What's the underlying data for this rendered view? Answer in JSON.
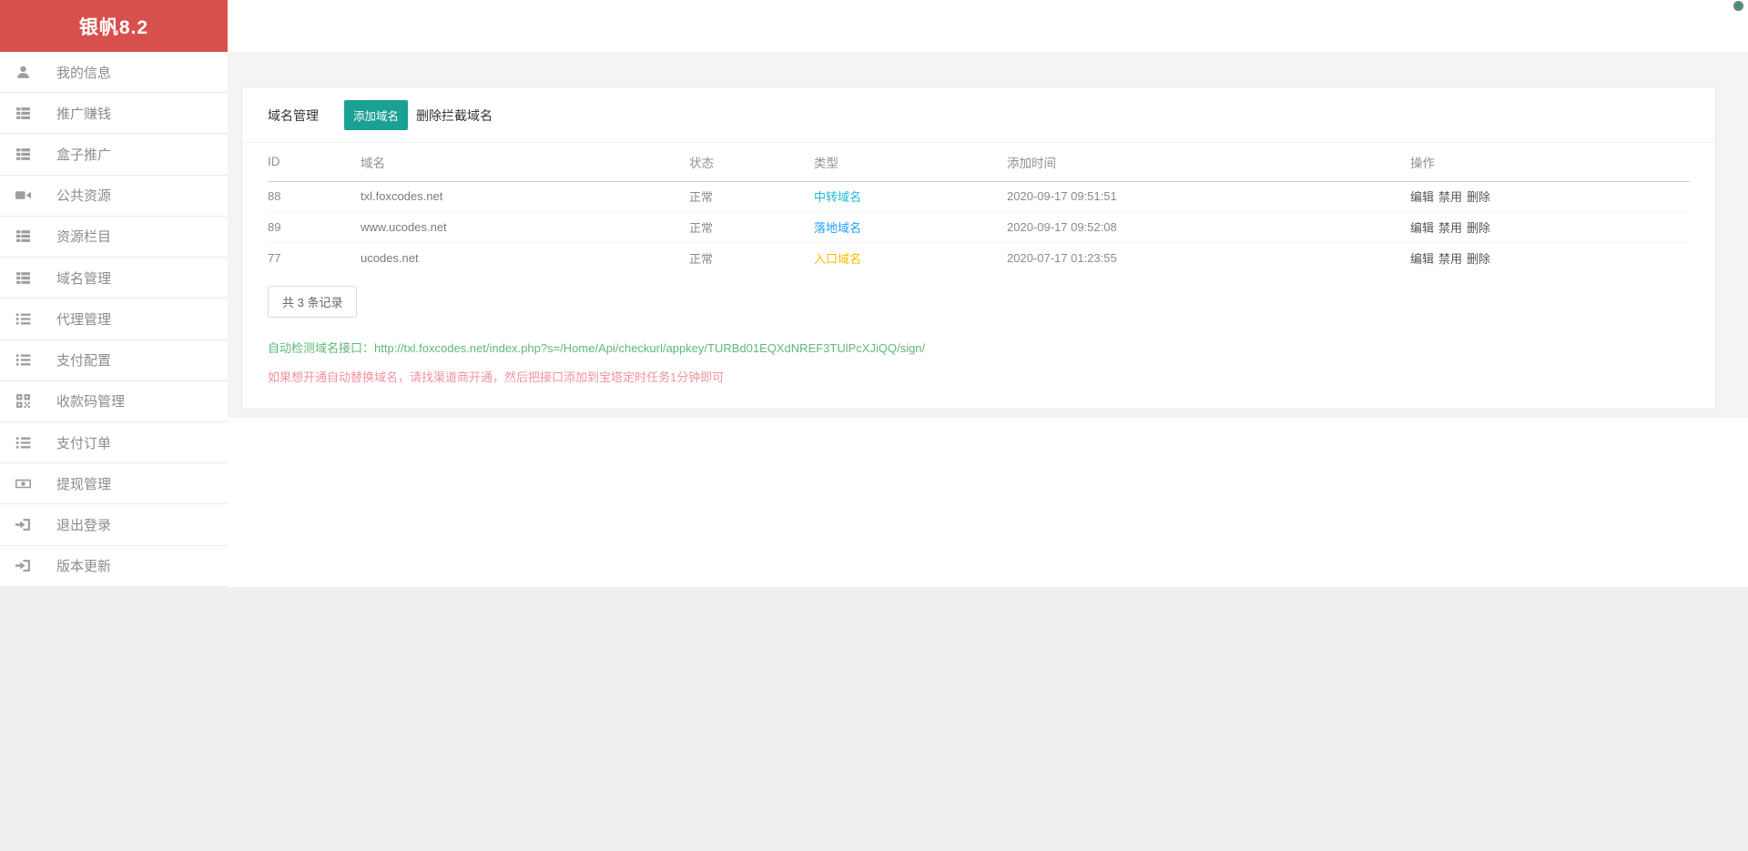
{
  "app": {
    "title": "银帆8.2"
  },
  "colors": {
    "brand": "#d8504d",
    "accent": "#1aa094",
    "type_transit": "#1cbbd4",
    "type_landing": "#1e9fff",
    "type_entry": "#ffb800",
    "success_text": "#5fb878",
    "warning_text": "#f1939e"
  },
  "sidebar": {
    "items": [
      {
        "label": "我的信息",
        "icon": "user-icon"
      },
      {
        "label": "推广赚钱",
        "icon": "th-list-icon"
      },
      {
        "label": "盒子推广",
        "icon": "th-list-icon"
      },
      {
        "label": "公共资源",
        "icon": "video-camera-icon"
      },
      {
        "label": "资源栏目",
        "icon": "th-list-icon"
      },
      {
        "label": "域名管理",
        "icon": "th-list-icon"
      },
      {
        "label": "代理管理",
        "icon": "list-ul-icon"
      },
      {
        "label": "支付配置",
        "icon": "list-ul-icon"
      },
      {
        "label": "收款码管理",
        "icon": "qrcode-icon"
      },
      {
        "label": "支付订单",
        "icon": "list-ul-icon"
      },
      {
        "label": "提现管理",
        "icon": "banknote-icon"
      },
      {
        "label": "退出登录",
        "icon": "sign-out-icon"
      },
      {
        "label": "版本更新",
        "icon": "sign-out-icon"
      }
    ]
  },
  "main": {
    "tabs": [
      {
        "label": "域名管理"
      },
      {
        "label": "添加域名",
        "active": true
      },
      {
        "label": "删除拦截域名"
      }
    ],
    "table": {
      "columns": [
        "ID",
        "域名",
        "状态",
        "类型",
        "添加时间",
        "操作"
      ],
      "rows": [
        {
          "id": "88",
          "domain": "txl.foxcodes.net",
          "status": "正常",
          "type": "中转域名",
          "type_color": "#1cbbd4",
          "added": "2020-09-17 09:51:51",
          "actions": [
            "编辑",
            "禁用",
            "删除"
          ]
        },
        {
          "id": "89",
          "domain": "www.ucodes.net",
          "status": "正常",
          "type": "落地域名",
          "type_color": "#1e9fff",
          "added": "2020-09-17 09:52:08",
          "actions": [
            "编辑",
            "禁用",
            "删除"
          ]
        },
        {
          "id": "77",
          "domain": "ucodes.net",
          "status": "正常",
          "type": "入口域名",
          "type_color": "#ffb800",
          "added": "2020-07-17 01:23:55",
          "actions": [
            "编辑",
            "禁用",
            "删除"
          ]
        }
      ]
    },
    "record_count": "共 3 条记录",
    "api": {
      "label": "自动检测域名接口：",
      "url": "http://txl.foxcodes.net/index.php?s=/Home/Api/checkurl/appkey/TURBd01EQXdNREF3TUlPcXJiQQ/sign/"
    },
    "hint": "如果想开通自动替换域名，请找渠道商开通，然后把接口添加到宝塔定时任务1分钟即可"
  }
}
